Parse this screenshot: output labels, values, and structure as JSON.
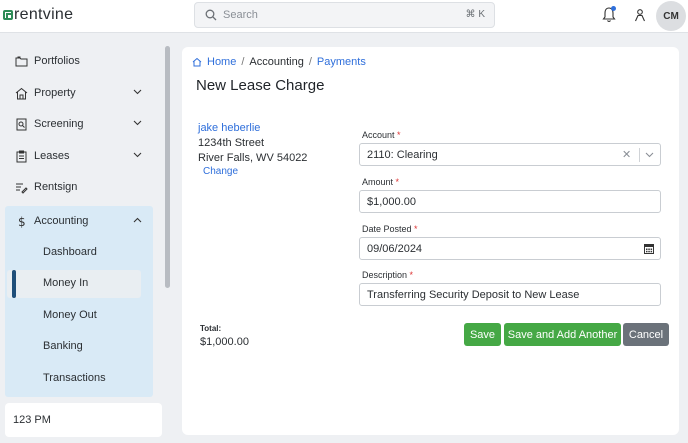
{
  "app": {
    "logo_text": "rentvine"
  },
  "search": {
    "placeholder": "Search",
    "shortcut": "⌘ K"
  },
  "user": {
    "initials": "CM"
  },
  "sidebar": {
    "items": [
      {
        "label": "Portfolios",
        "icon": "folders-icon"
      },
      {
        "label": "Property",
        "icon": "house-icon"
      },
      {
        "label": "Screening",
        "icon": "screening-icon"
      },
      {
        "label": "Leases",
        "icon": "clipboard-icon"
      },
      {
        "label": "Rentsign",
        "icon": "signature-icon"
      },
      {
        "label": "Accounting",
        "icon": "dollar-icon"
      }
    ],
    "accounting_sub": [
      "Dashboard",
      "Money In",
      "Money Out",
      "Banking",
      "Transactions"
    ],
    "active_sub": "Money In",
    "time": "123 PM"
  },
  "breadcrumb": {
    "home": "Home",
    "section": "Accounting",
    "page": "Payments"
  },
  "page": {
    "title": "New Lease Charge"
  },
  "tenant": {
    "name": "jake heberlie",
    "street": "1234th Street",
    "city": "River Falls, WV 54022",
    "change_label": "Change"
  },
  "form": {
    "account_label": "Account",
    "account_value": "2110: Clearing",
    "amount_label": "Amount",
    "amount_value": "$1,000.00",
    "date_label": "Date Posted",
    "date_value": "09/06/2024",
    "description_label": "Description",
    "description_value": "Transferring Security Deposit to New Lease",
    "required_mark": "*"
  },
  "total": {
    "label": "Total:",
    "value": "$1,000.00"
  },
  "buttons": {
    "save": "Save",
    "save_add": "Save and Add Another",
    "cancel": "Cancel"
  },
  "colors": {
    "accent": "#2f6fdb",
    "save": "#45a845",
    "cancel": "#6b727a",
    "accounting_bg": "#d9eaf6"
  }
}
